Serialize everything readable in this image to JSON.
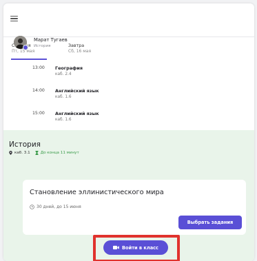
{
  "header": {
    "menu_icon": "hamburger-menu-icon"
  },
  "tabs": [
    {
      "label": "Сегодня",
      "date": "Пт, 15 мая"
    },
    {
      "label": "Завтра",
      "date": "Сб, 16 мая"
    }
  ],
  "lessons": [
    {
      "time": "13:00",
      "name": "География",
      "room": "каб. 2.4"
    },
    {
      "time": "14:00",
      "name": "Английский язык",
      "room": "каб. 1.6"
    },
    {
      "time": "15:00",
      "name": "Английский язык",
      "room": "каб. 1.6"
    }
  ],
  "current": {
    "title": "История",
    "room": "каб. 3.1",
    "timer": "До конца 11 минут",
    "teacher": {
      "name": "Марат Тугаев",
      "subject": "История"
    },
    "assignment": {
      "title": "Становление эллинистического мира",
      "deadline": "30 дней, до 15 июня",
      "button": "Выбрать задания"
    },
    "join_button": "Войти в класс"
  },
  "colors": {
    "accent": "#5a4fd6",
    "panel_bg": "#e9f4ea",
    "timer_green": "#3a9b4a",
    "highlight_red": "#e0322d"
  }
}
